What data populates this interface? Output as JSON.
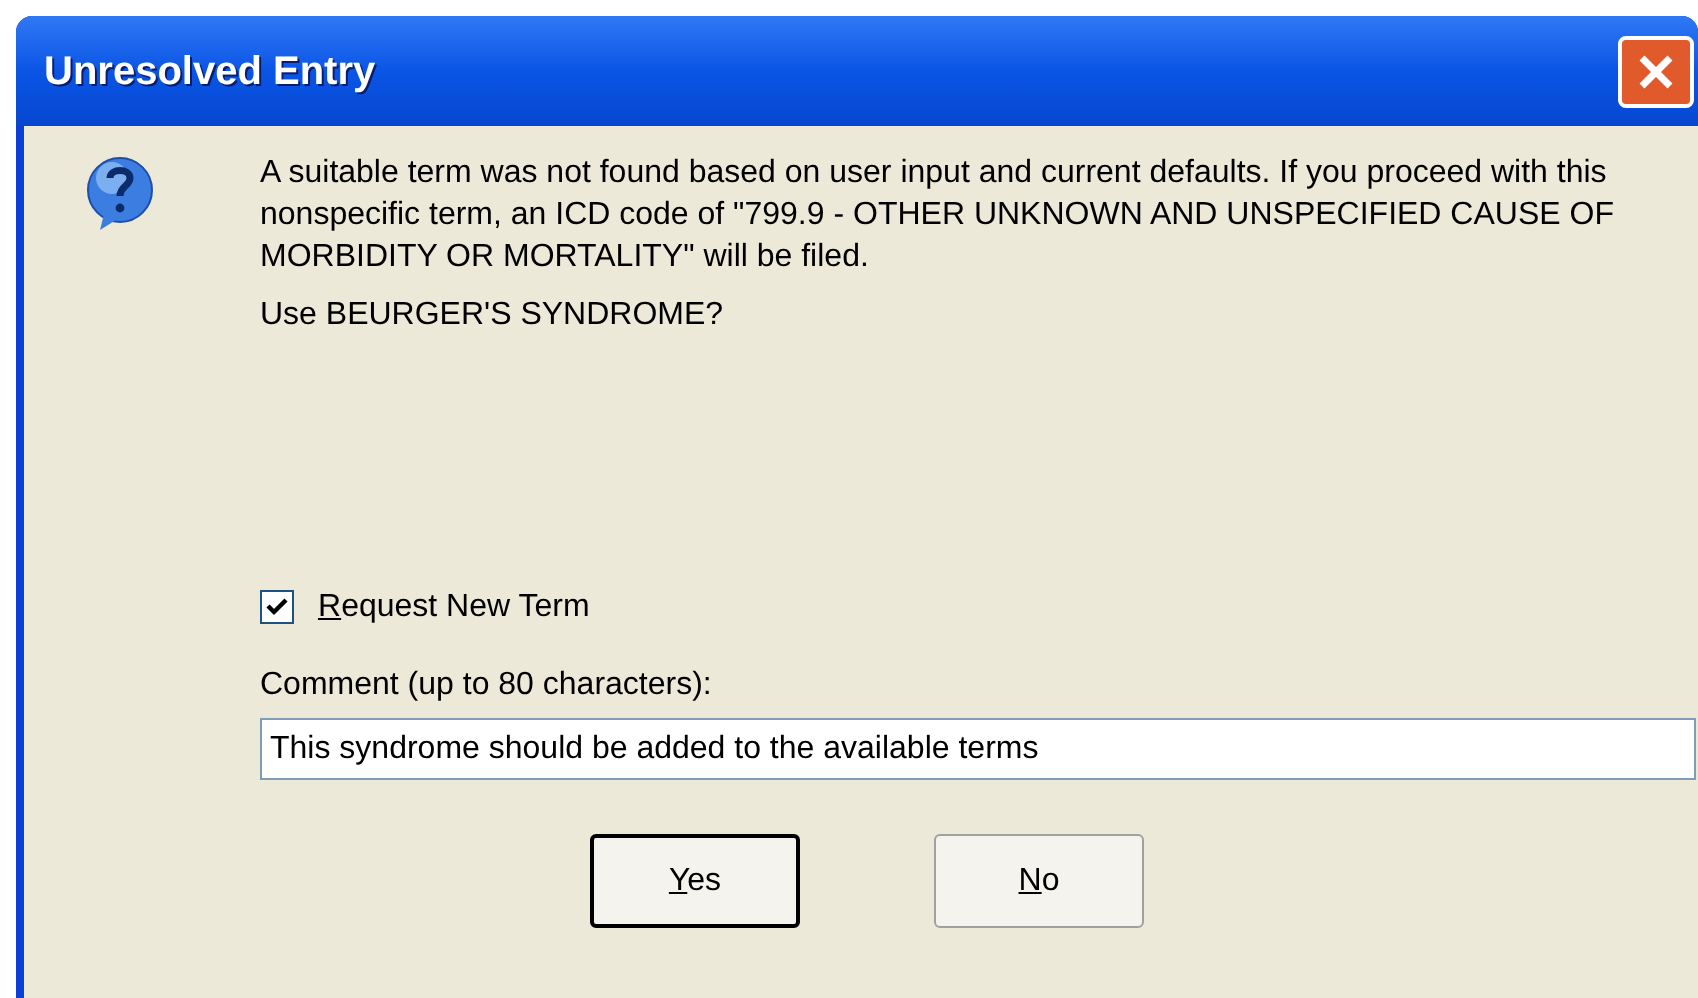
{
  "window": {
    "title": "Unresolved Entry"
  },
  "message": "A suitable term was not found based on user input and current defaults. If you proceed with this nonspecific term, an ICD code of \"799.9 - OTHER UNKNOWN AND UNSPECIFIED CAUSE OF MORBIDITY OR MORTALITY\" will be filed.",
  "question": "Use BEURGER'S SYNDROME?",
  "request_new_term": {
    "label": "Request New Term",
    "checked": true
  },
  "comment": {
    "label": "Comment (up to 80 characters):",
    "value": "This syndrome should be added to the available terms"
  },
  "buttons": [
    {
      "label": "Yes",
      "default": true
    },
    {
      "label": "No",
      "default": false
    }
  ]
}
